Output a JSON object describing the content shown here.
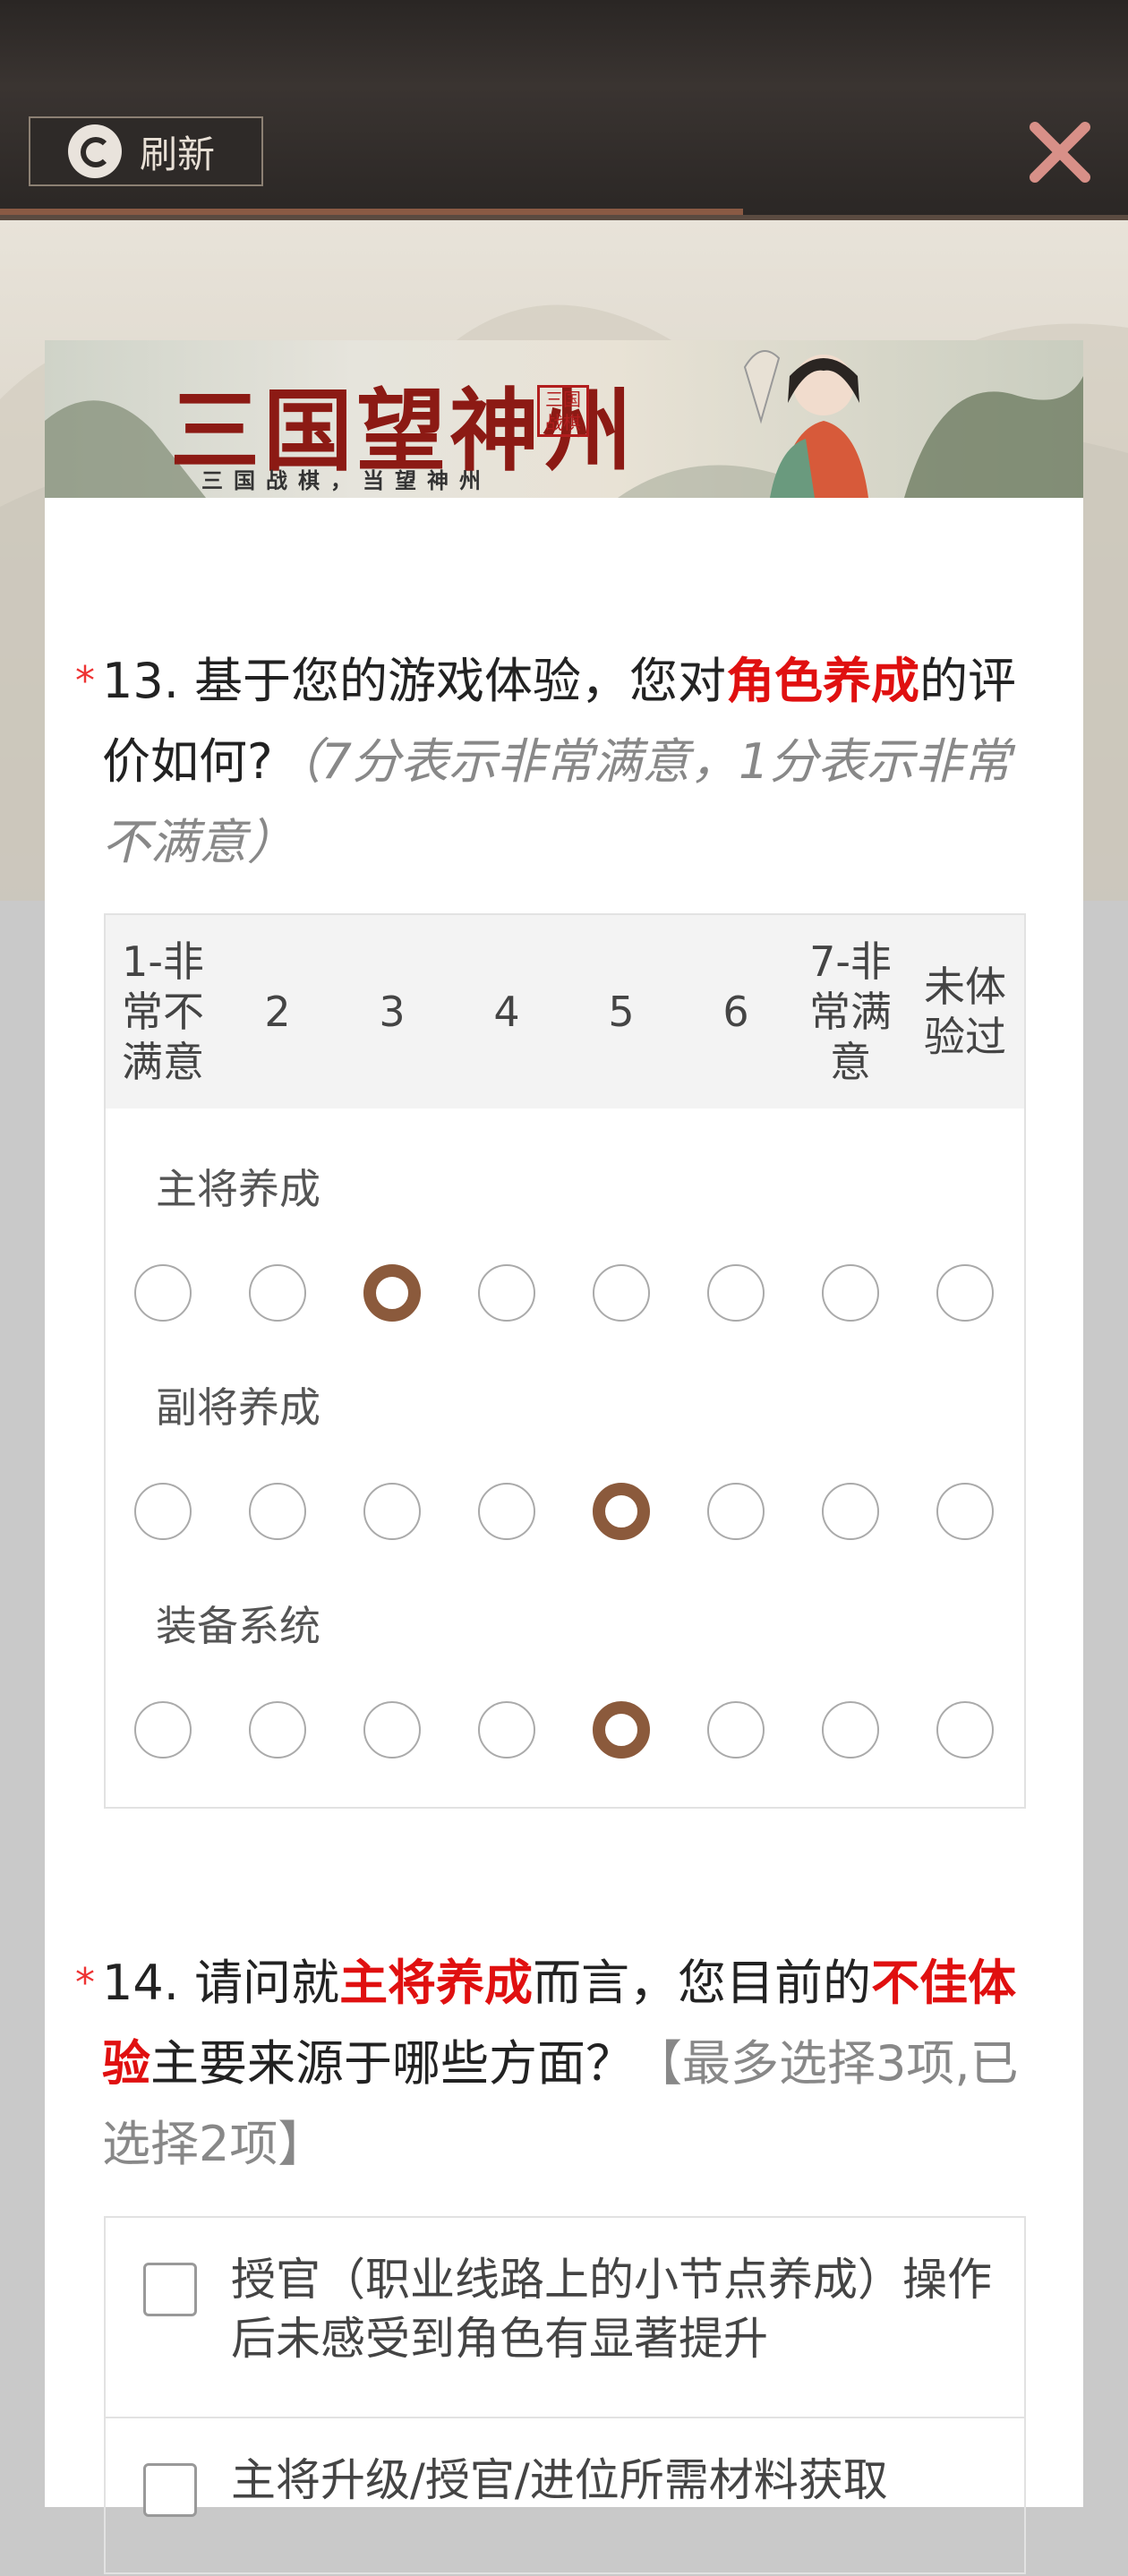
{
  "topbar": {
    "refresh_label": "刷新"
  },
  "banner": {
    "title": "三国望神州",
    "seal": "三国战棋",
    "subtitle": "三国战棋，当望神州"
  },
  "q13": {
    "required_mark": "*",
    "number": "13.",
    "text_a": "基于您的游戏体验，您对",
    "highlight": "角色养成",
    "text_b": "的评价如何?",
    "hint": "（7分表示非常满意，1分表示非常不满意）",
    "columns": [
      "1-非常不满意",
      "2",
      "3",
      "4",
      "5",
      "6",
      "7-非常满意",
      "未体验过"
    ],
    "rows": [
      {
        "label": "主将养成",
        "selected_index": 2
      },
      {
        "label": "副将养成",
        "selected_index": 4
      },
      {
        "label": "装备系统",
        "selected_index": 4
      }
    ]
  },
  "q14": {
    "required_mark": "*",
    "number": "14.",
    "text_a": "请问就",
    "highlight_a": "主将养成",
    "text_b": "而言，您目前的",
    "highlight_b": "不佳体验",
    "text_c": "主要来源于哪些方面？",
    "limit_text": "【最多选择3项,已选择2项】",
    "options": [
      {
        "label": "授官（职业线路上的小节点养成）操作后未感受到角色有显著提升",
        "checked": false
      },
      {
        "label": "主将升级/授官/进位所需材料获取",
        "checked": false
      }
    ]
  },
  "colors": {
    "accent_red": "#e01010",
    "radio_checked": "#8b5a3c",
    "required": "#e33"
  },
  "icons": [
    "refresh-icon",
    "close-icon"
  ]
}
